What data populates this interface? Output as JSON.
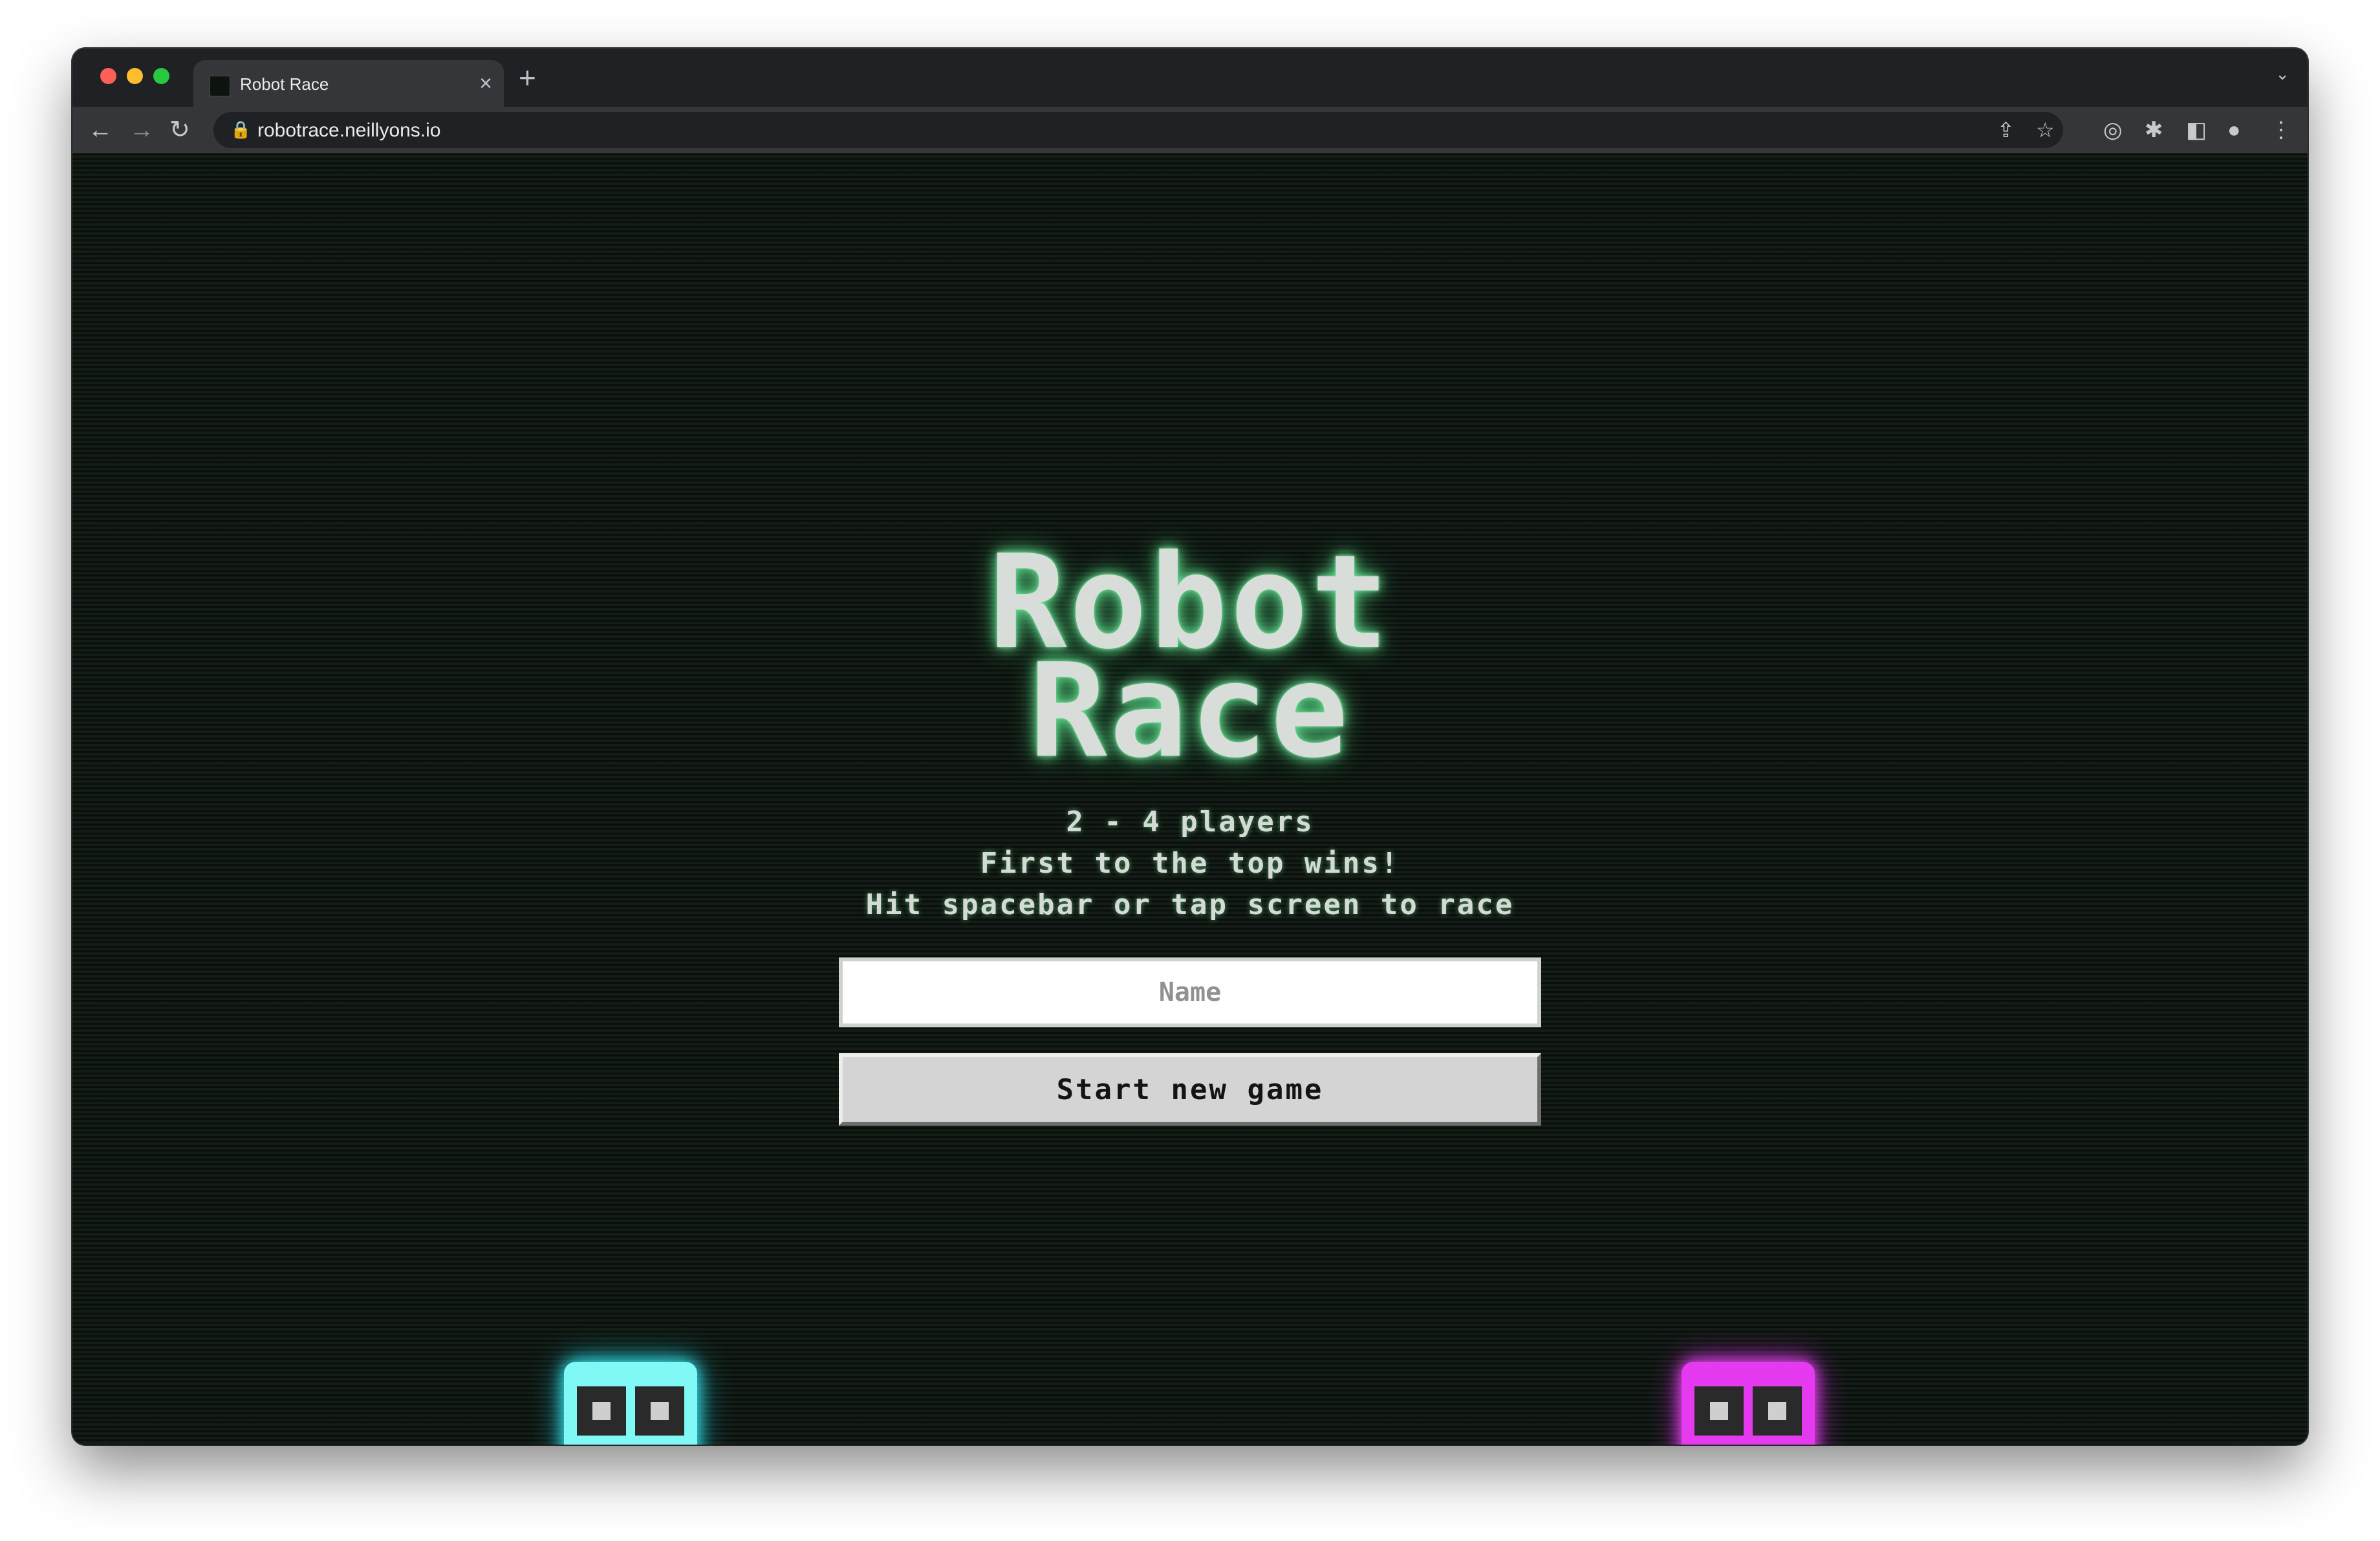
{
  "browser": {
    "tab_title": "Robot Race",
    "tab_close": "×",
    "new_tab": "+",
    "tab_menu": "⌄",
    "url": "robotrace.neillyons.io",
    "nav": {
      "back": "←",
      "forward": "→",
      "reload": "↻"
    },
    "icons": {
      "lock": "🔒",
      "share": "⇪",
      "star": "☆",
      "extension_circle": "◎",
      "puzzle": "✱",
      "sidebar": "◧",
      "profile": "●",
      "menu": "⋮"
    }
  },
  "game": {
    "title_line1": "Robot",
    "title_line2": "Race",
    "info_lines": [
      "2 - 4 players",
      "First to the top wins!",
      "Hit spacebar or tap screen to race"
    ],
    "name_placeholder": "Name",
    "start_button": "Start new game",
    "robots": [
      {
        "color": "#7ff8f6",
        "name": "cyan-robot"
      },
      {
        "color": "#e63af0",
        "name": "pink-robot"
      }
    ]
  },
  "colors": {
    "background": "#101712",
    "title_glow": "#6ee89a"
  }
}
